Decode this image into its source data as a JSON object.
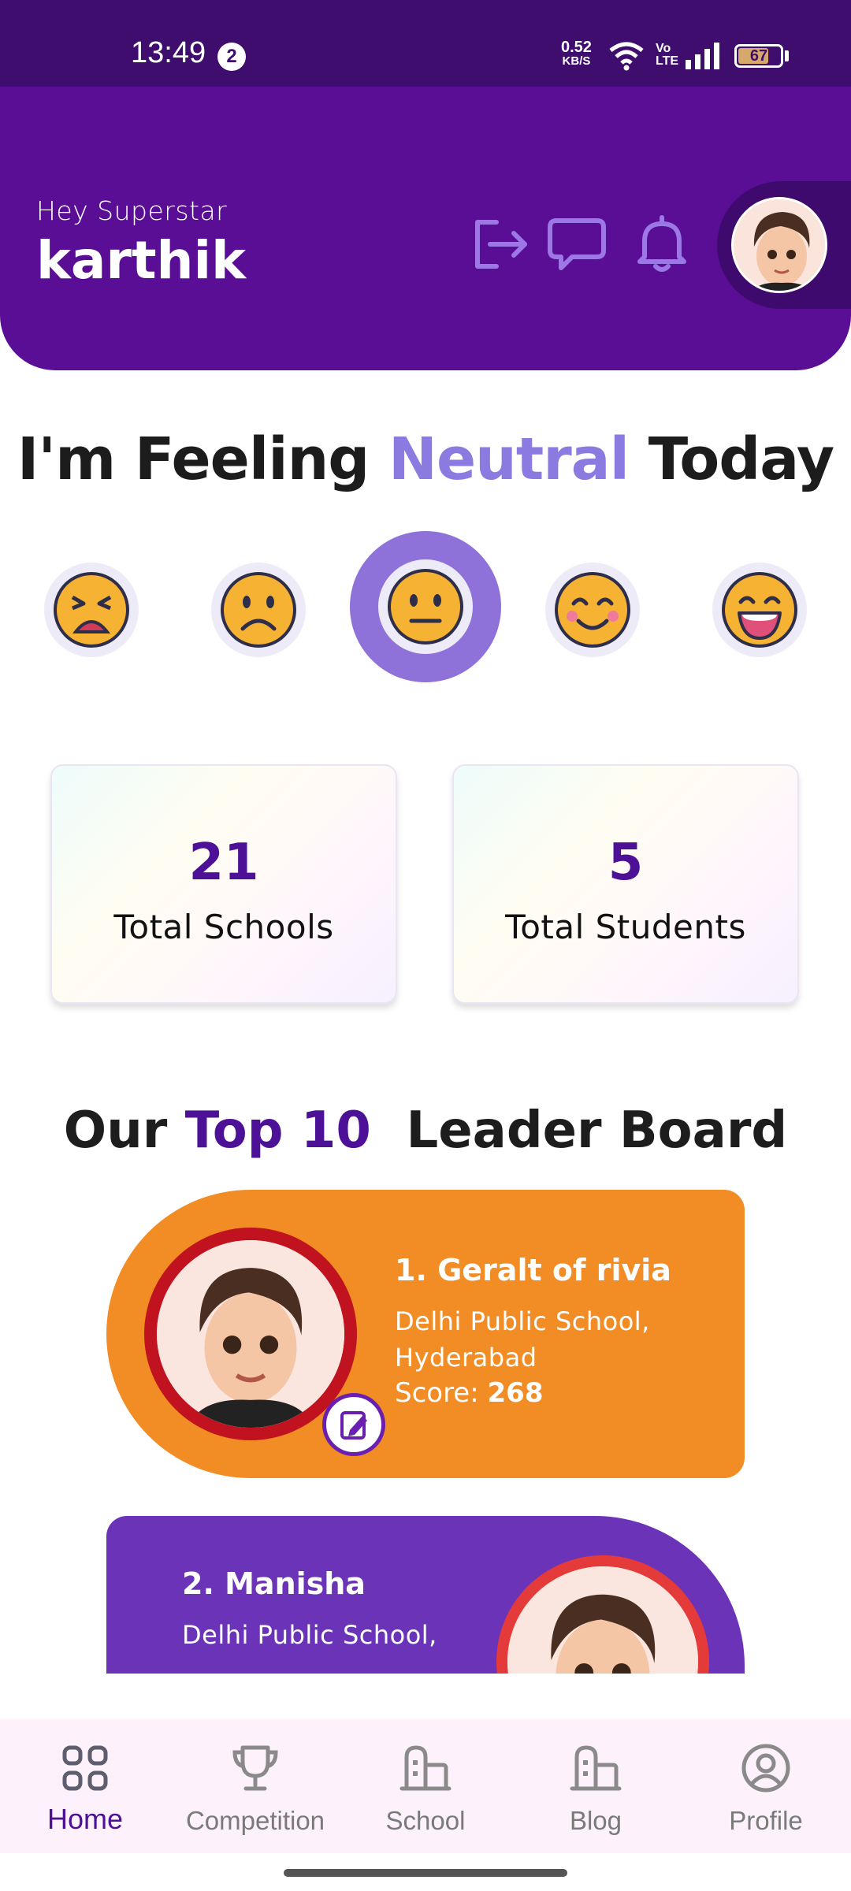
{
  "status_bar": {
    "time": "13:49",
    "notification_count": "2",
    "net_speed_value": "0.52",
    "net_speed_unit": "KB/S",
    "volte": "Vo\nLTE",
    "battery": "67"
  },
  "header": {
    "greeting": "Hey Superstar",
    "username": "karthik",
    "icons": [
      "logout-icon",
      "chat-icon",
      "bell-icon"
    ]
  },
  "feeling": {
    "prefix": "I'm Feeling ",
    "mood": "Neutral",
    "suffix": " Today",
    "moods": [
      "tired",
      "sad",
      "neutral",
      "happy",
      "joyful"
    ],
    "selected": "neutral"
  },
  "stats": [
    {
      "value": "21",
      "label": "Total Schools"
    },
    {
      "value": "5",
      "label": "Total Students"
    }
  ],
  "leaderboard": {
    "title_prefix": "Our ",
    "title_accent": "Top 10",
    "title_suffix": "  Leader Board",
    "entries": [
      {
        "name": "1. Geralt of rivia",
        "school_line1": "Delhi Public School,",
        "school_line2": "Hyderabad",
        "score_label": "Score: ",
        "score": "268",
        "color": "#f28c25"
      },
      {
        "name": "2. Manisha",
        "school_line1": "Delhi Public School,",
        "color": "#6b34b8"
      }
    ]
  },
  "bottom_nav": {
    "items": [
      {
        "label": "Home",
        "icon": "grid-icon",
        "active": true
      },
      {
        "label": "Competition",
        "icon": "trophy-icon",
        "active": false
      },
      {
        "label": "School",
        "icon": "building-icon",
        "active": false
      },
      {
        "label": "Blog",
        "icon": "building-icon",
        "active": false
      },
      {
        "label": "Profile",
        "icon": "user-circle-icon",
        "active": false
      }
    ]
  },
  "colors": {
    "primary": "#5a0e96",
    "status_bar": "#3f0d6e",
    "mood_accent": "#8b7be0",
    "text_accent": "#4c1196",
    "leader_1": "#f28c25",
    "leader_2": "#6b34b8"
  }
}
